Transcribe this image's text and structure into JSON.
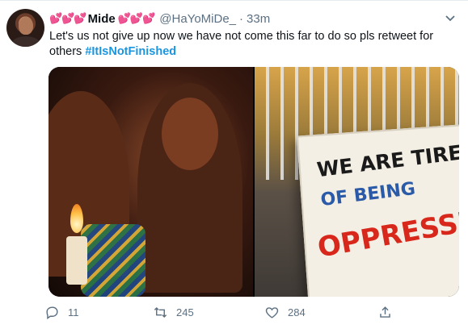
{
  "tweet": {
    "display_name": "Mide",
    "name_decoration_left": "💕💕💕",
    "name_decoration_right": "💕💕💕",
    "handle": "@HaYoMiDe_",
    "separator": "·",
    "timestamp": "33m",
    "text": "Let's us not give up now we have not come this far to do so pls retweet for others",
    "hashtag": "#ItIsNotFinished",
    "media": {
      "sign_line_1": "WE ARE TIRED",
      "sign_line_2": "OF BEING",
      "sign_line_3": "OPPRESSED"
    },
    "actions": {
      "replies": "11",
      "retweets": "245",
      "likes": "284"
    }
  },
  "icons": {
    "more": "chevron-down-icon",
    "reply": "reply-icon",
    "retweet": "retweet-icon",
    "like": "heart-icon",
    "share": "share-icon"
  },
  "colors": {
    "hashtag": "#1b95e0",
    "secondary_text": "#5b7083",
    "hearts": "#d9244a"
  }
}
